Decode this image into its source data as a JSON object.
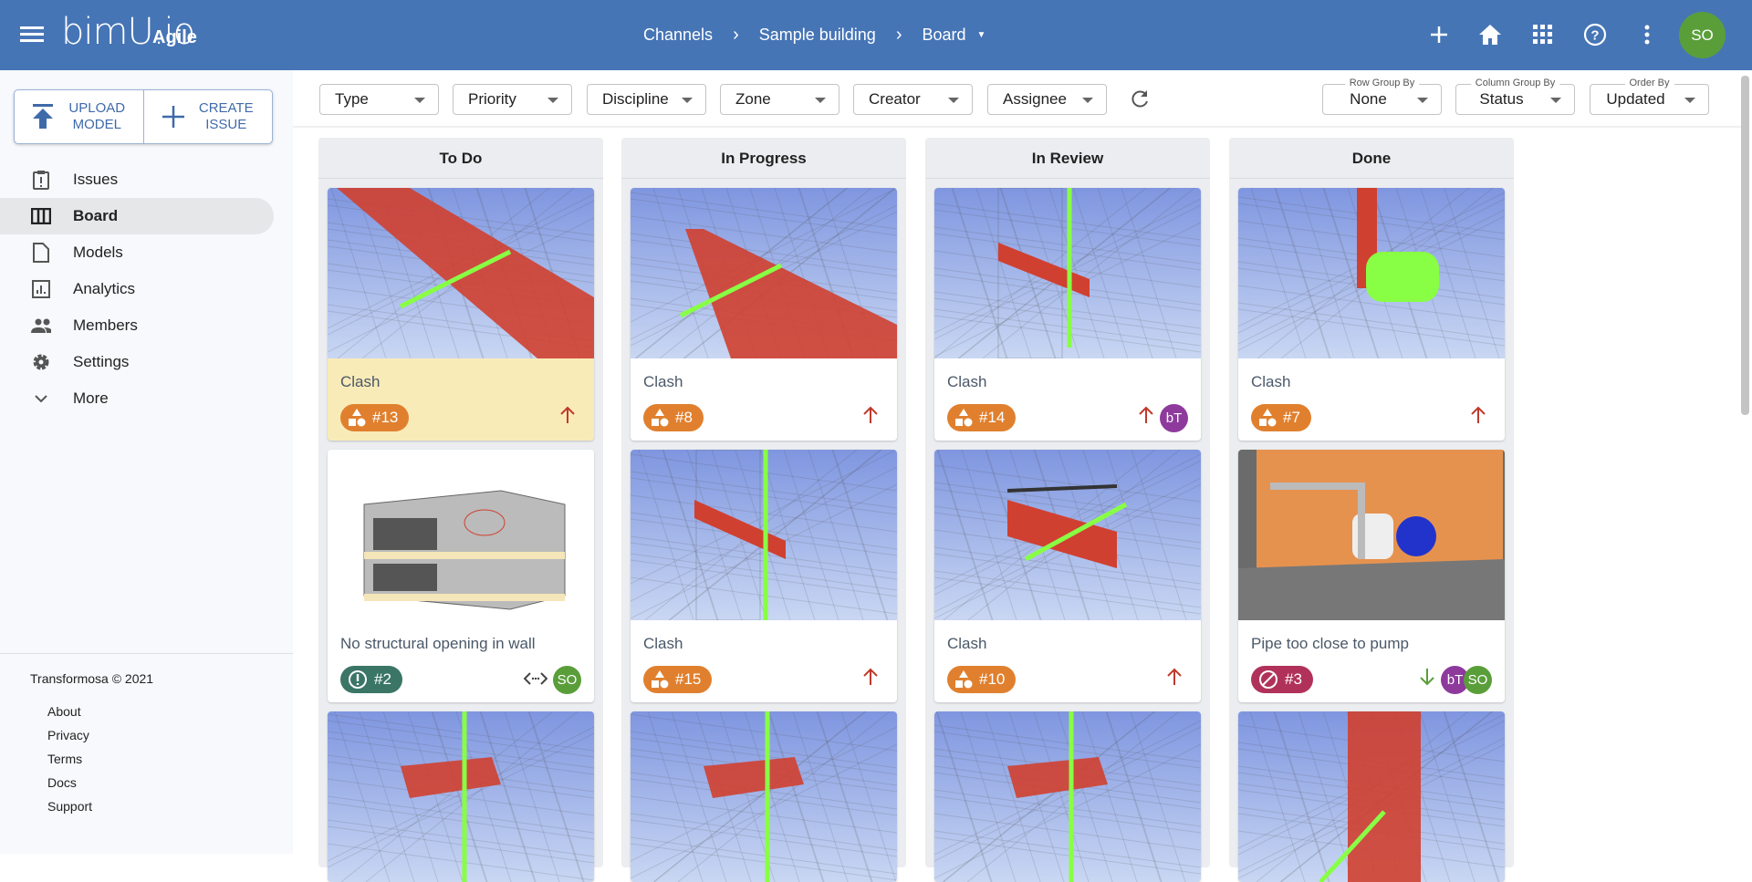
{
  "header": {
    "logo": "bimU.io",
    "product": "Agile",
    "breadcrumbs": [
      "Channels",
      "Sample building",
      "Board"
    ],
    "user_initials": "SO"
  },
  "sidebar": {
    "upload": [
      "UPLOAD",
      "MODEL"
    ],
    "create": [
      "CREATE",
      "ISSUE"
    ],
    "items": [
      {
        "label": "Issues",
        "icon": "clipboard-alert-icon"
      },
      {
        "label": "Board",
        "icon": "board-columns-icon",
        "active": true
      },
      {
        "label": "Models",
        "icon": "file-icon"
      },
      {
        "label": "Analytics",
        "icon": "analytics-icon"
      },
      {
        "label": "Members",
        "icon": "people-icon"
      },
      {
        "label": "Settings",
        "icon": "gear-icon"
      },
      {
        "label": "More",
        "icon": "chevron-down-icon"
      }
    ],
    "footer": {
      "copyright": "Transformosa © 2021",
      "links": [
        "About",
        "Privacy",
        "Terms",
        "Docs",
        "Support"
      ]
    }
  },
  "filters": [
    "Type",
    "Priority",
    "Discipline",
    "Zone",
    "Creator",
    "Assignee"
  ],
  "groupings": [
    {
      "label": "Row Group By",
      "value": "None"
    },
    {
      "label": "Column Group By",
      "value": "Status"
    },
    {
      "label": "Order By",
      "value": "Updated"
    }
  ],
  "colors": {
    "clash": "#e0802e",
    "issue": "#3a7565",
    "blocked": "#b0325a",
    "high": "#c0392b",
    "low": "#5a9e3a",
    "bT": "#8e3a9d",
    "SO": "#5a9e3a"
  },
  "columns": [
    {
      "title": "To Do",
      "cards": [
        {
          "title": "Clash",
          "number": "#13",
          "type": "clash",
          "priority": "high",
          "assignees": [],
          "highlight": true
        },
        {
          "title": "No structural opening in wall",
          "number": "#2",
          "type": "issue",
          "priority": "code",
          "assignees": [
            "SO"
          ]
        }
      ]
    },
    {
      "title": "In Progress",
      "cards": [
        {
          "title": "Clash",
          "number": "#8",
          "type": "clash",
          "priority": "high",
          "assignees": []
        },
        {
          "title": "Clash",
          "number": "#15",
          "type": "clash",
          "priority": "high",
          "assignees": []
        }
      ]
    },
    {
      "title": "In Review",
      "cards": [
        {
          "title": "Clash",
          "number": "#14",
          "type": "clash",
          "priority": "high",
          "assignees": [
            "bT"
          ]
        },
        {
          "title": "Clash",
          "number": "#10",
          "type": "clash",
          "priority": "high",
          "assignees": []
        }
      ]
    },
    {
      "title": "Done",
      "cards": [
        {
          "title": "Clash",
          "number": "#7",
          "type": "clash",
          "priority": "high",
          "assignees": []
        },
        {
          "title": "Pipe too close to pump",
          "number": "#3",
          "type": "blocked",
          "priority": "low",
          "assignees": [
            "bT",
            "SO"
          ]
        }
      ]
    }
  ]
}
